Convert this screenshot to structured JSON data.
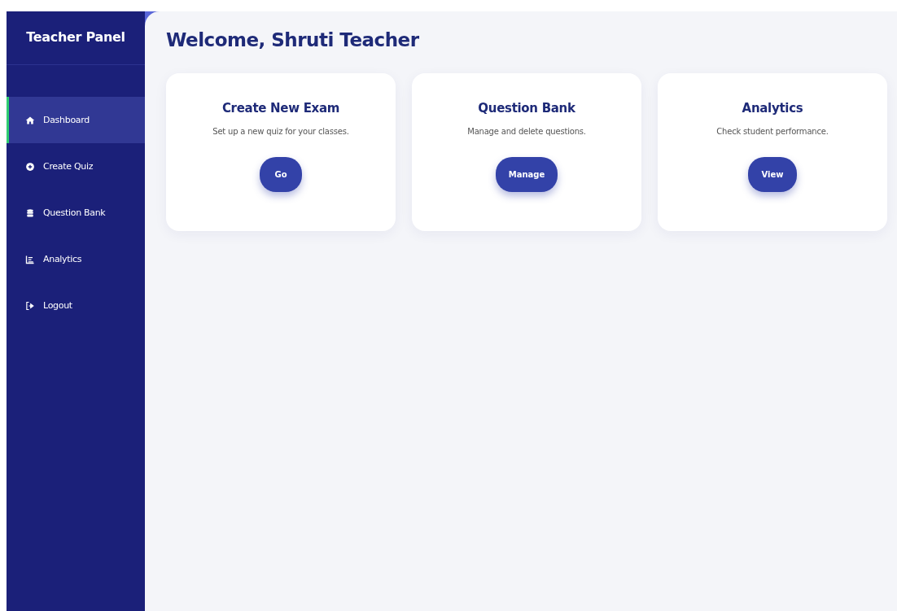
{
  "sidebar": {
    "title": "Teacher Panel",
    "items": [
      {
        "label": "Dashboard",
        "selected": true
      },
      {
        "label": "Create Quiz",
        "selected": false
      },
      {
        "label": "Question Bank",
        "selected": false
      },
      {
        "label": "Analytics",
        "selected": false
      },
      {
        "label": "Logout",
        "selected": false
      }
    ]
  },
  "main": {
    "heading": "Welcome, Shruti Teacher",
    "cards": [
      {
        "title": "Create New Exam",
        "description": "Set up a new quiz for your classes.",
        "button": "Go"
      },
      {
        "title": "Question Bank",
        "description": "Manage and delete questions.",
        "button": "Manage"
      },
      {
        "title": "Analytics",
        "description": "Check student performance.",
        "button": "View"
      }
    ]
  }
}
